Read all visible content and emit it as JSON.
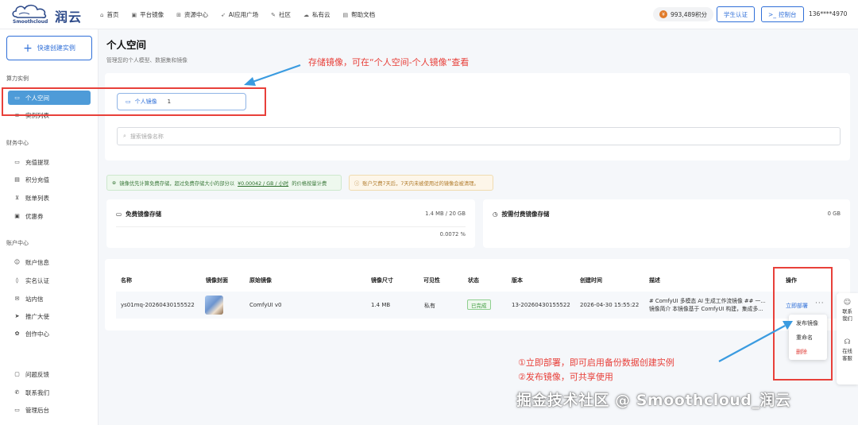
{
  "header": {
    "brand_en": "Smoothcloud",
    "brand_cn": "润云",
    "nav": [
      {
        "label": "首页",
        "icon": "home-icon"
      },
      {
        "label": "平台镜像",
        "icon": "box-icon"
      },
      {
        "label": "资源中心",
        "icon": "grid-icon"
      },
      {
        "label": "AI应用广场",
        "icon": "rocket-icon"
      },
      {
        "label": "社区",
        "icon": "tag-icon"
      },
      {
        "label": "私有云",
        "icon": "cloud-icon"
      },
      {
        "label": "帮助文档",
        "icon": "book-icon"
      }
    ],
    "points": "993,489积分",
    "student_btn": "学生认证",
    "console_btn": "控制台",
    "console_icon": ">_",
    "user": "136****4970"
  },
  "sidebar": {
    "quick_create": "快速创建实例",
    "sections": [
      {
        "title": "算力实例",
        "items": [
          {
            "label": "个人空间",
            "icon": "folder-icon",
            "active": true
          },
          {
            "label": "实例列表",
            "icon": "list-icon",
            "active": false
          }
        ]
      },
      {
        "title": "财务中心",
        "items": [
          {
            "label": "充值提现",
            "icon": "card-icon"
          },
          {
            "label": "积分充值",
            "icon": "wallet-icon"
          },
          {
            "label": "账单列表",
            "icon": "cart-icon"
          },
          {
            "label": "优惠券",
            "icon": "coupon-icon"
          }
        ]
      },
      {
        "title": "账户中心",
        "items": [
          {
            "label": "账户信息",
            "icon": "user-icon"
          },
          {
            "label": "实名认证",
            "icon": "shield-icon"
          },
          {
            "label": "站内信",
            "icon": "mail-icon"
          },
          {
            "label": "推广大使",
            "icon": "send-icon"
          },
          {
            "label": "创作中心",
            "icon": "palette-icon"
          }
        ]
      }
    ],
    "bottom": [
      {
        "label": "问题反馈",
        "icon": "chat-icon"
      },
      {
        "label": "联系我们",
        "icon": "phone-icon"
      },
      {
        "label": "管理后台",
        "icon": "monitor-icon"
      }
    ]
  },
  "main": {
    "title": "个人空间",
    "subtitle": "管理您的个人模型、数据集和镜像",
    "tab_label": "个人镜像",
    "tab_count": "1",
    "search_placeholder": "搜索镜像名称",
    "notice_green_pre": "镜像优先计算免费存储，超过免费存储大小的部分以",
    "notice_green_price": "¥0.00042 / GB / 小时",
    "notice_green_post": "的价格按量计费",
    "notice_orange": "账户欠费7天后，7天内未被使用过的镜像会被清理。",
    "free_storage": {
      "title": "免费镜像存储",
      "value": "1.4 MB / 20 GB",
      "percent": "0.0072 %"
    },
    "paid_storage": {
      "title": "按需付费镜像存储",
      "value": "0 GB"
    },
    "table": {
      "headers": [
        "名称",
        "镜像封面",
        "原始镜像",
        "镜像尺寸",
        "可见性",
        "状态",
        "版本",
        "创建时间",
        "描述",
        "操作"
      ],
      "rows": [
        {
          "name": "ys01mq-20260430155522",
          "origin": "ComfyUI v0",
          "size": "1.4 MB",
          "visibility": "私有",
          "status": "已完成",
          "version": "13-20260430155522",
          "created": "2026-04-30 15:55:22",
          "desc_line1": "# ComfyUI 多模态 AI 生成工作流镜像 ## 一...",
          "desc_line2": "镜像简介 本镜像基于 ComfyUI 构建，集成多...",
          "action": "立即部署",
          "more": "···"
        }
      ]
    },
    "dropdown": [
      "发布镜像",
      "重命名",
      "删除"
    ]
  },
  "float_bar": [
    {
      "label_1": "联系",
      "label_2": "我们",
      "icon": "contact-icon"
    },
    {
      "label_1": "在线",
      "label_2": "客服",
      "icon": "headset-icon"
    }
  ],
  "annotations": {
    "top": "存储镜像，可在“个人空间-个人镜像”查看",
    "bottom_1": "①立即部署，即可启用备份数据创建实例",
    "bottom_2": "②发布镜像，可共享使用",
    "color": "#e8403a"
  },
  "watermark": "掘金技术社区 @ Smoothcloud_润云"
}
